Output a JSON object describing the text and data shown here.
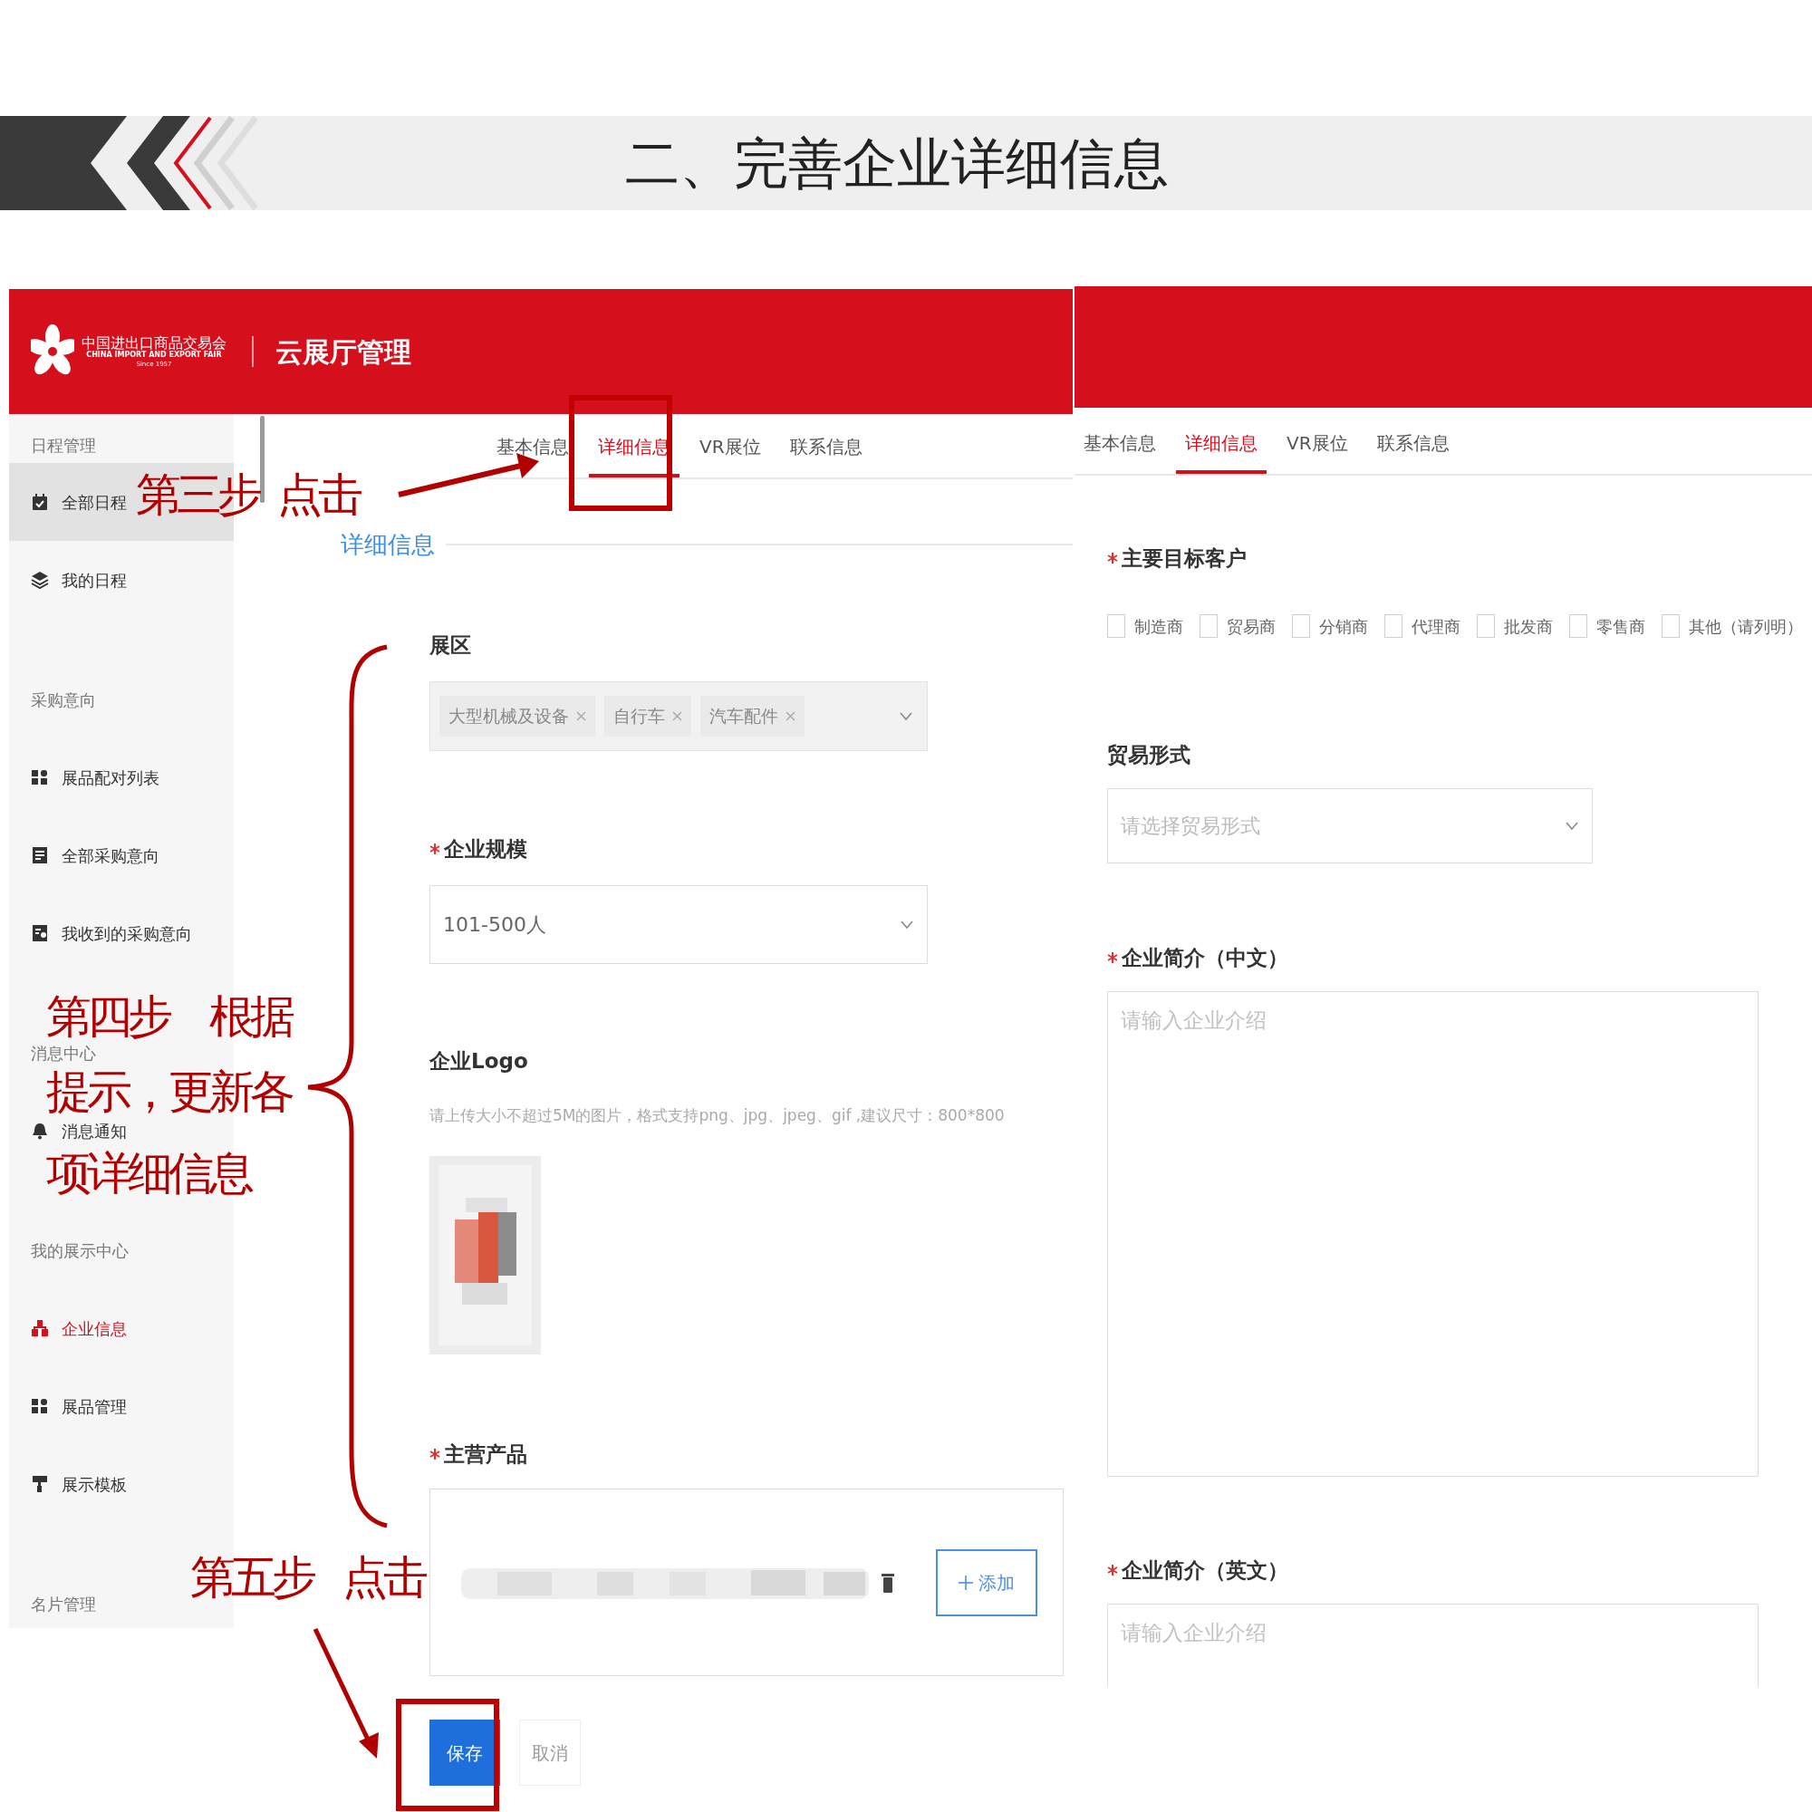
{
  "slide": {
    "title": "二、完善企业详细信息"
  },
  "left_screen": {
    "header": {
      "logo_cn": "中国进出口商品交易会",
      "logo_en": "CHINA IMPORT AND EXPORT FAIR",
      "logo_since": "Since 1957",
      "title": "云展厅管理"
    },
    "sidebar": [
      {
        "kind": "group",
        "label": "日程管理"
      },
      {
        "kind": "item",
        "label": "全部日程",
        "hovered": true,
        "selected": false
      },
      {
        "kind": "item",
        "label": "我的日程",
        "hovered": false,
        "selected": false
      },
      {
        "kind": "group",
        "label": "采购意向"
      },
      {
        "kind": "item",
        "label": "展品配对列表",
        "hovered": false,
        "selected": false
      },
      {
        "kind": "item",
        "label": "全部采购意向",
        "hovered": false,
        "selected": false
      },
      {
        "kind": "item",
        "label": "我收到的采购意向",
        "hovered": false,
        "selected": false
      },
      {
        "kind": "group",
        "label": "消息中心"
      },
      {
        "kind": "item",
        "label": "消息通知",
        "hovered": false,
        "selected": false
      },
      {
        "kind": "group",
        "label": "我的展示中心"
      },
      {
        "kind": "item",
        "label": "企业信息",
        "hovered": false,
        "selected": true
      },
      {
        "kind": "item",
        "label": "展品管理",
        "hovered": false,
        "selected": false
      },
      {
        "kind": "item",
        "label": "展示模板",
        "hovered": false,
        "selected": false
      },
      {
        "kind": "group",
        "label": "名片管理"
      }
    ],
    "tabs": [
      {
        "label": "基本信息",
        "selected": false
      },
      {
        "label": "详细信息",
        "selected": true
      },
      {
        "label": "VR展位",
        "selected": false
      },
      {
        "label": "联系信息",
        "selected": false
      }
    ],
    "section_title": "详细信息",
    "fields": [
      {
        "kind": "tags",
        "label": "展区",
        "required": false,
        "tags": [
          "大型机械及设备",
          "自行车",
          "汽车配件"
        ]
      },
      {
        "kind": "select",
        "label": "企业规模",
        "required": true,
        "value": "101-500人"
      },
      {
        "kind": "upload",
        "label": "企业Logo",
        "required": false,
        "hint": "请上传大小不超过5M的图片，格式支持png、jpg、jpeg、gif ,建议尺寸：800*800"
      },
      {
        "kind": "products",
        "label": "主营产品",
        "required": true,
        "add_label": "添加"
      }
    ],
    "buttons": [
      {
        "kind": "primary",
        "label": "保存"
      },
      {
        "kind": "default",
        "label": "取消"
      }
    ]
  },
  "right_screen": {
    "tabs": [
      {
        "label": "基本信息",
        "selected": false
      },
      {
        "label": "详细信息",
        "selected": true
      },
      {
        "label": "VR展位",
        "selected": false
      },
      {
        "label": "联系信息",
        "selected": false
      }
    ],
    "fields": [
      {
        "kind": "checkboxes",
        "label": "主要目标客户",
        "required": true,
        "options": [
          {
            "label": "制造商",
            "checked": false
          },
          {
            "label": "贸易商",
            "checked": false
          },
          {
            "label": "分销商",
            "checked": false
          },
          {
            "label": "代理商",
            "checked": false
          },
          {
            "label": "批发商",
            "checked": false
          },
          {
            "label": "零售商",
            "checked": false
          },
          {
            "label": "其他（请列明）",
            "checked": false
          }
        ]
      },
      {
        "kind": "select",
        "label": "贸易形式",
        "required": false,
        "placeholder": "请选择贸易形式"
      },
      {
        "kind": "textarea",
        "label": "企业简介（中文）",
        "required": true,
        "placeholder": "请输入企业介绍"
      },
      {
        "kind": "textarea",
        "label": "企业简介（英文）",
        "required": true,
        "placeholder": "请输入企业介绍"
      }
    ]
  },
  "annotations": [
    {
      "text": "第三步"
    },
    {
      "text": "点击"
    },
    {
      "text": "第四步　根据"
    },
    {
      "text": "提示，更新各"
    },
    {
      "text": "项详细信息"
    },
    {
      "text": "第五步"
    },
    {
      "text": "点击"
    }
  ]
}
